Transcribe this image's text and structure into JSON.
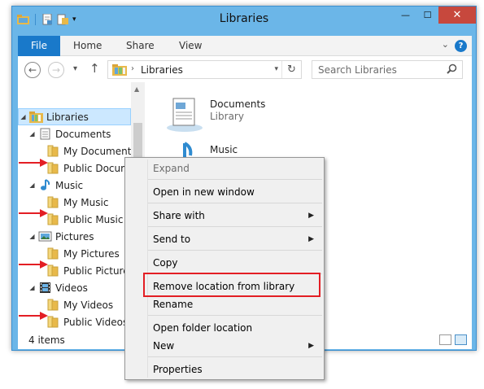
{
  "window": {
    "title": "Libraries"
  },
  "ribbon": {
    "tabs": [
      "File",
      "Home",
      "Share",
      "View"
    ],
    "help": "?"
  },
  "address": {
    "crumb": "Libraries"
  },
  "search": {
    "placeholder": "Search Libraries"
  },
  "nav": {
    "items": [
      {
        "label": "Libraries"
      },
      {
        "label": "Documents"
      },
      {
        "label": "My Documents"
      },
      {
        "label": "Public Documents"
      },
      {
        "label": "Music"
      },
      {
        "label": "My Music"
      },
      {
        "label": "Public Music"
      },
      {
        "label": "Pictures"
      },
      {
        "label": "My Pictures"
      },
      {
        "label": "Public Pictures"
      },
      {
        "label": "Videos"
      },
      {
        "label": "My Videos"
      },
      {
        "label": "Public Videos"
      }
    ]
  },
  "content": {
    "libraries": [
      {
        "name": "Documents",
        "type": "Library"
      },
      {
        "name": "Music",
        "type": ""
      }
    ]
  },
  "status": {
    "count": "4 items"
  },
  "context_menu": {
    "items": [
      {
        "label": "Expand",
        "disabled": true
      },
      {
        "label": "Open in new window"
      },
      {
        "label": "Share with",
        "submenu": true
      },
      {
        "label": "Send to",
        "submenu": true
      },
      {
        "label": "Copy"
      },
      {
        "label": "Remove location from library"
      },
      {
        "label": "Rename"
      },
      {
        "label": "Open folder location"
      },
      {
        "label": "New",
        "submenu": true
      },
      {
        "label": "Properties"
      }
    ]
  },
  "colors": {
    "accent": "#1979ca",
    "highlight": "#e31e24",
    "window_frame": "#6bb6e8",
    "close": "#c7483d",
    "selection": "#cce8ff"
  }
}
